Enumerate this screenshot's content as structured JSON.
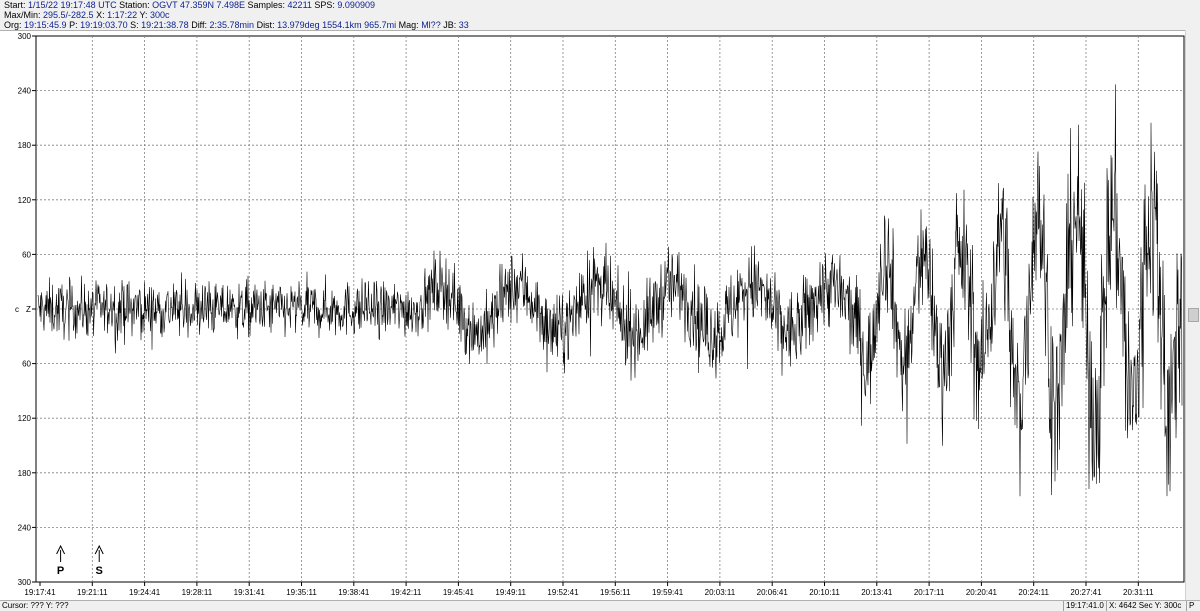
{
  "header": {
    "line1": [
      {
        "t": "Start: ",
        "c": "lbl"
      },
      {
        "t": "1/15/22 19:17:48 UTC",
        "c": "v"
      },
      {
        "t": " Station: ",
        "c": "lbl"
      },
      {
        "t": "OGVT 47.359N 7.498E",
        "c": "v"
      },
      {
        "t": " Samples: ",
        "c": "lbl"
      },
      {
        "t": "42211",
        "c": "v"
      },
      {
        "t": "  SPS: ",
        "c": "lbl"
      },
      {
        "t": "9.090909",
        "c": "v"
      }
    ],
    "line2": [
      {
        "t": "Max/Min: ",
        "c": "lbl"
      },
      {
        "t": " 295.5/-282.5",
        "c": "v"
      },
      {
        "t": " X: ",
        "c": "lbl"
      },
      {
        "t": "1:17:22",
        "c": "v"
      },
      {
        "t": " Y: ",
        "c": "lbl"
      },
      {
        "t": "300c",
        "c": "v"
      }
    ],
    "line3": [
      {
        "t": "Org: ",
        "c": "lbl"
      },
      {
        "t": "19:15:45.9",
        "c": "v"
      },
      {
        "t": " P: ",
        "c": "lbl"
      },
      {
        "t": "19:19:03.70",
        "c": "v"
      },
      {
        "t": " S: ",
        "c": "lbl"
      },
      {
        "t": "19:21:38.78",
        "c": "v"
      },
      {
        "t": " Diff: ",
        "c": "lbl"
      },
      {
        "t": "2:35.78min",
        "c": "v"
      },
      {
        "t": " Dist: ",
        "c": "lbl"
      },
      {
        "t": "13.979deg 1554.1km 965.7mi",
        "c": "v"
      },
      {
        "t": "  Mag: ",
        "c": "lbl"
      },
      {
        "t": "Ml??",
        "c": "v"
      },
      {
        "t": " JB: ",
        "c": "lbl"
      },
      {
        "t": "33",
        "c": "v"
      }
    ]
  },
  "plot": {
    "y_labels": [
      "300",
      "240",
      "180",
      "120",
      "60",
      "",
      "60",
      "120",
      "180",
      "240",
      "300"
    ],
    "y_values": [
      300,
      240,
      180,
      120,
      60,
      0,
      -60,
      -120,
      -180,
      -240,
      -300
    ],
    "center_labels": {
      "left": "c",
      "right": "Z"
    },
    "x_labels": [
      "19:17:41",
      "19:21:11",
      "19:24:41",
      "19:28:11",
      "19:31:41",
      "19:35:11",
      "19:38:41",
      "19:42:11",
      "19:45:41",
      "19:49:11",
      "19:52:41",
      "19:56:11",
      "19:59:41",
      "20:03:11",
      "20:06:41",
      "20:10:11",
      "20:13:41",
      "20:17:11",
      "20:20:41",
      "20:24:11",
      "20:27:41",
      "20:31:11"
    ],
    "phase_markers": [
      {
        "label": "P",
        "time": "19:19:03.70"
      },
      {
        "label": "S",
        "time": "19:21:38.78"
      }
    ]
  },
  "colors": {
    "trace": "#000000",
    "grid": "#808080",
    "header_value": "#0b1f8f",
    "background": "#ffffff"
  },
  "status": {
    "cursor": "Cursor: ???  Y: ???",
    "time": "19:17:41.0",
    "xinfo": "X: 4642 Sec  Y: 300c",
    "tail": "P"
  }
}
